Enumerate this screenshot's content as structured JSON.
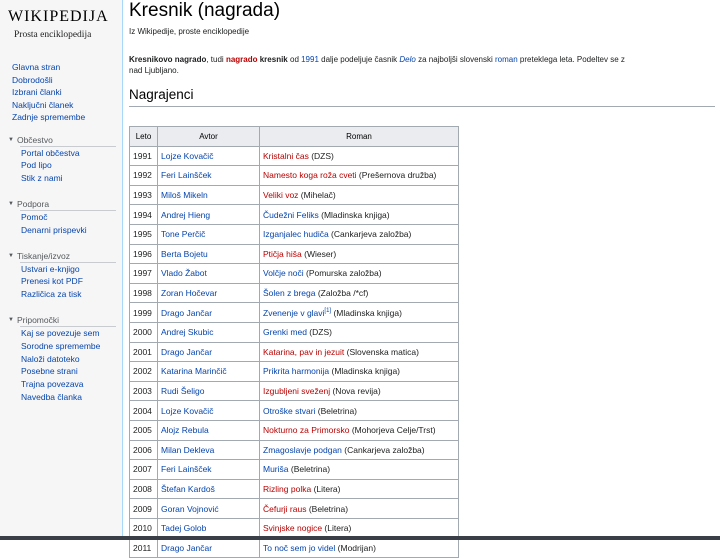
{
  "sidebar": {
    "logo": {
      "wordmark": "WIKIPEDIJA",
      "tagline": "Prosta enciklopedija"
    },
    "main_links": [
      "Glavna stran",
      "Dobrodošli",
      "Izbrani članki",
      "Naključni članek",
      "Zadnje spremembe"
    ],
    "sections": [
      {
        "title": "Občestvo",
        "items": [
          "Portal občestva",
          "Pod lipo",
          "Stik z nami"
        ]
      },
      {
        "title": "Podpora",
        "items": [
          "Pomoč",
          "Denarni prispevki"
        ]
      },
      {
        "title": "Tiskanje/izvoz",
        "items": [
          "Ustvari e-knjigo",
          "Prenesi kot PDF",
          "Različica za tisk"
        ]
      },
      {
        "title": "Pripomočki",
        "items": [
          "Kaj se povezuje sem",
          "Sorodne spremembe",
          "Naloži datoteko",
          "Posebne strani",
          "Trajna povezava",
          "Navedba članka"
        ]
      }
    ]
  },
  "article": {
    "title": "Kresnik (nagrada)",
    "subtitle": "Iz Wikipedije, proste enciklopedije",
    "intro": {
      "line1": [
        {
          "t": "Kresnikovo nagrado",
          "s": "b"
        },
        {
          "t": ", tudi ",
          "s": ""
        },
        {
          "t": "nagrado",
          "s": "red"
        },
        {
          "t": " ",
          "s": ""
        },
        {
          "t": "kresnik",
          "s": "b"
        },
        {
          "t": " od ",
          "s": ""
        },
        {
          "t": "1991",
          "s": "blue"
        },
        {
          "t": " dalje podeljuje časnik ",
          "s": ""
        },
        {
          "t": "Delo",
          "s": "ital"
        },
        {
          "t": " za najboljši slovenski ",
          "s": ""
        },
        {
          "t": "roman",
          "s": "blue"
        },
        {
          "t": " preteklega leta. Podeltev se z",
          "s": ""
        }
      ],
      "line2": "nad Ljubljano."
    },
    "section_heading": "Nagrajenci",
    "table": {
      "headers": [
        "Leto",
        "Avtor",
        "Roman"
      ],
      "rows": [
        {
          "year": "1991",
          "author": "Lojze Kovačič",
          "novel": "Kristalni čas",
          "novel_color": "red",
          "publisher": " (DZS)"
        },
        {
          "year": "1992",
          "author": "Feri Lainšček",
          "novel": "Namesto koga roža cveti",
          "novel_color": "red",
          "publisher": " (Prešernova družba)"
        },
        {
          "year": "1993",
          "author": "Miloš Mikeln",
          "novel": "Veliki voz",
          "novel_color": "red",
          "publisher": " (Mihelač)"
        },
        {
          "year": "1994",
          "author": "Andrej Hieng",
          "novel": "Čudežni Feliks",
          "novel_color": "blue",
          "publisher": " (Mladinska knjiga)"
        },
        {
          "year": "1995",
          "author": "Tone Perčič",
          "novel": "Izganjalec hudiča",
          "novel_color": "blue",
          "publisher": " (Cankarjeva založba)"
        },
        {
          "year": "1996",
          "author": "Berta Bojetu",
          "novel": "Ptičja hiša",
          "novel_color": "red",
          "publisher": " (Wieser)"
        },
        {
          "year": "1997",
          "author": "Vlado Žabot",
          "novel": "Volčje noči",
          "novel_color": "blue",
          "publisher": " (Pomurska založba)"
        },
        {
          "year": "1998",
          "author": "Zoran Hočevar",
          "novel": "Šolen z brega",
          "novel_color": "blue",
          "publisher": " (Založba /*cf)"
        },
        {
          "year": "1999",
          "author": "Drago Jančar",
          "novel": "Zvenenje v glavi",
          "novel_color": "blue",
          "publisher": " (Mladinska knjiga)",
          "ref": "[1]"
        },
        {
          "year": "2000",
          "author": "Andrej Skubic",
          "novel": "Grenki med",
          "novel_color": "blue",
          "publisher": " (DZS)"
        },
        {
          "year": "2001",
          "author": "Drago Jančar",
          "novel": "Katarina, pav in jezuit",
          "novel_color": "red",
          "publisher": " (Slovenska matica)"
        },
        {
          "year": "2002",
          "author": "Katarina Marinčič",
          "novel": "Prikrita harmonija",
          "novel_color": "blue",
          "publisher": " (Mladinska knjiga)"
        },
        {
          "year": "2003",
          "author": "Rudi Šeligo",
          "novel": "Izgubljeni sveženj",
          "novel_color": "red",
          "publisher": " (Nova revija)"
        },
        {
          "year": "2004",
          "author": "Lojze Kovačič",
          "novel": "Otroške stvari",
          "novel_color": "blue",
          "publisher": " (Beletrina)"
        },
        {
          "year": "2005",
          "author": "Alojz Rebula",
          "novel": "Nokturno za Primorsko",
          "novel_color": "red",
          "publisher": " (Mohorjeva Celje/Trst)"
        },
        {
          "year": "2006",
          "author": "Milan Dekleva",
          "novel": "Zmagoslavje podgan",
          "novel_color": "blue",
          "publisher": " (Cankarjeva založba)"
        },
        {
          "year": "2007",
          "author": "Feri Lainšček",
          "novel": "Muriša",
          "novel_color": "blue",
          "publisher": " (Beletrina)"
        },
        {
          "year": "2008",
          "author": "Štefan Kardoš",
          "novel": "Rizling polka",
          "novel_color": "red",
          "publisher": " (Litera)"
        },
        {
          "year": "2009",
          "author": "Goran Vojnović",
          "novel": "Čefurji raus",
          "novel_color": "red",
          "publisher": " (Beletrina)"
        },
        {
          "year": "2010",
          "author": "Tadej Golob",
          "novel": "Svinjske nogice",
          "novel_color": "red",
          "publisher": " (Litera)"
        },
        {
          "year": "2011",
          "author": "Drago Jančar",
          "novel": "To noč sem jo videl",
          "novel_color": "blue",
          "publisher": " (Modrijan)"
        }
      ]
    }
  },
  "colors": {
    "link": "#0645ad",
    "redlink": "#ba0000",
    "sidebar_bg": "#f6f6f6",
    "table_header_bg": "#eaecf0"
  }
}
